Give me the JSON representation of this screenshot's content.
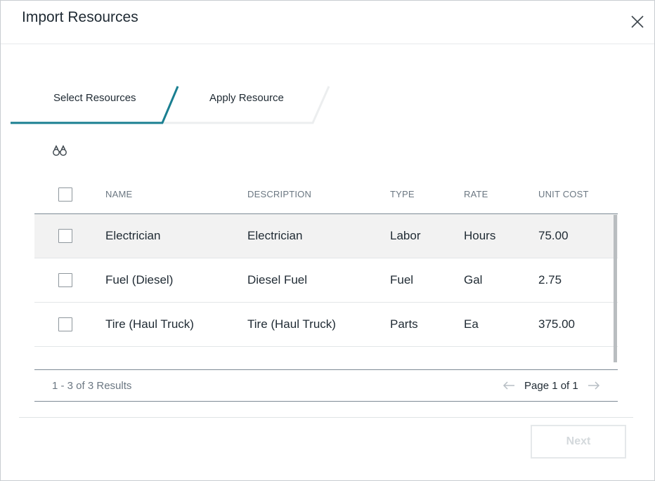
{
  "dialog": {
    "title": "Import Resources"
  },
  "tabs": [
    {
      "label": "Select Resources",
      "active": true
    },
    {
      "label": "Apply Resource",
      "active": false
    }
  ],
  "colors": {
    "accent": "#1a7f91",
    "row_selected": "#f2f2f2",
    "header_text": "#6b7782"
  },
  "icons": {
    "search": "binoculars-icon",
    "close": "close-icon",
    "prev": "arrow-left-icon",
    "next": "arrow-right-icon"
  },
  "table": {
    "columns": [
      "NAME",
      "DESCRIPTION",
      "TYPE",
      "RATE",
      "UNIT COST"
    ],
    "rows": [
      {
        "name": "Electrician",
        "description": "Electrician",
        "type": "Labor",
        "rate": "Hours",
        "unit_cost": "75.00",
        "selected": true
      },
      {
        "name": "Fuel (Diesel)",
        "description": "Diesel Fuel",
        "type": "Fuel",
        "rate": "Gal",
        "unit_cost": "2.75",
        "selected": false
      },
      {
        "name": "Tire (Haul Truck)",
        "description": "Tire (Haul Truck)",
        "type": "Parts",
        "rate": "Ea",
        "unit_cost": "375.00",
        "selected": false
      }
    ]
  },
  "pagination": {
    "results": "1 - 3 of 3 Results",
    "page": "Page 1 of 1"
  },
  "actions": {
    "next_label": "Next"
  }
}
